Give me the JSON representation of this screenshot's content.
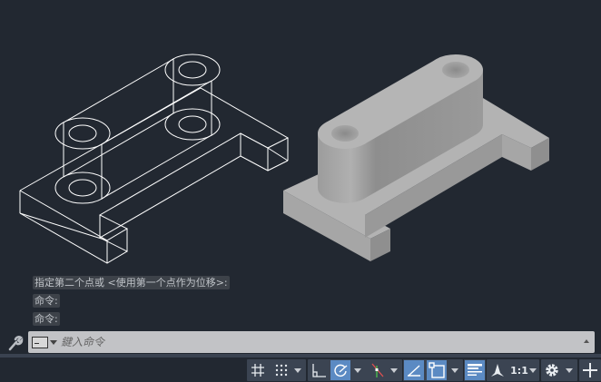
{
  "command_history": [
    "指定第二个点或 <使用第一个点作为位移>:",
    "命令:",
    "命令:"
  ],
  "command_input": {
    "placeholder": "鍵入命令",
    "value": ""
  },
  "status_bar": {
    "buttons": [
      {
        "icon": "grid-icon",
        "active": false
      },
      {
        "icon": "snap-icon",
        "active": false
      },
      {
        "icon": "ortho-icon",
        "active": false
      },
      {
        "icon": "polar-tracking-icon",
        "active": true
      },
      {
        "icon": "isometric-drafting-icon",
        "active": false
      },
      {
        "icon": "object-snap-tracking-icon",
        "active": true
      },
      {
        "icon": "object-snap-icon",
        "active": true
      },
      {
        "icon": "lineweight-icon",
        "active": true
      },
      {
        "icon": "annotation-visibility-icon",
        "active": false
      },
      {
        "icon": "gear-icon",
        "active": false
      },
      {
        "icon": "customize-plus-icon",
        "active": false
      }
    ],
    "annotation_scale": "1:1"
  },
  "colors": {
    "background": "#222831",
    "active": "#5b8ac3",
    "wire": "#ffffff",
    "solid": "#a9a9a9"
  }
}
